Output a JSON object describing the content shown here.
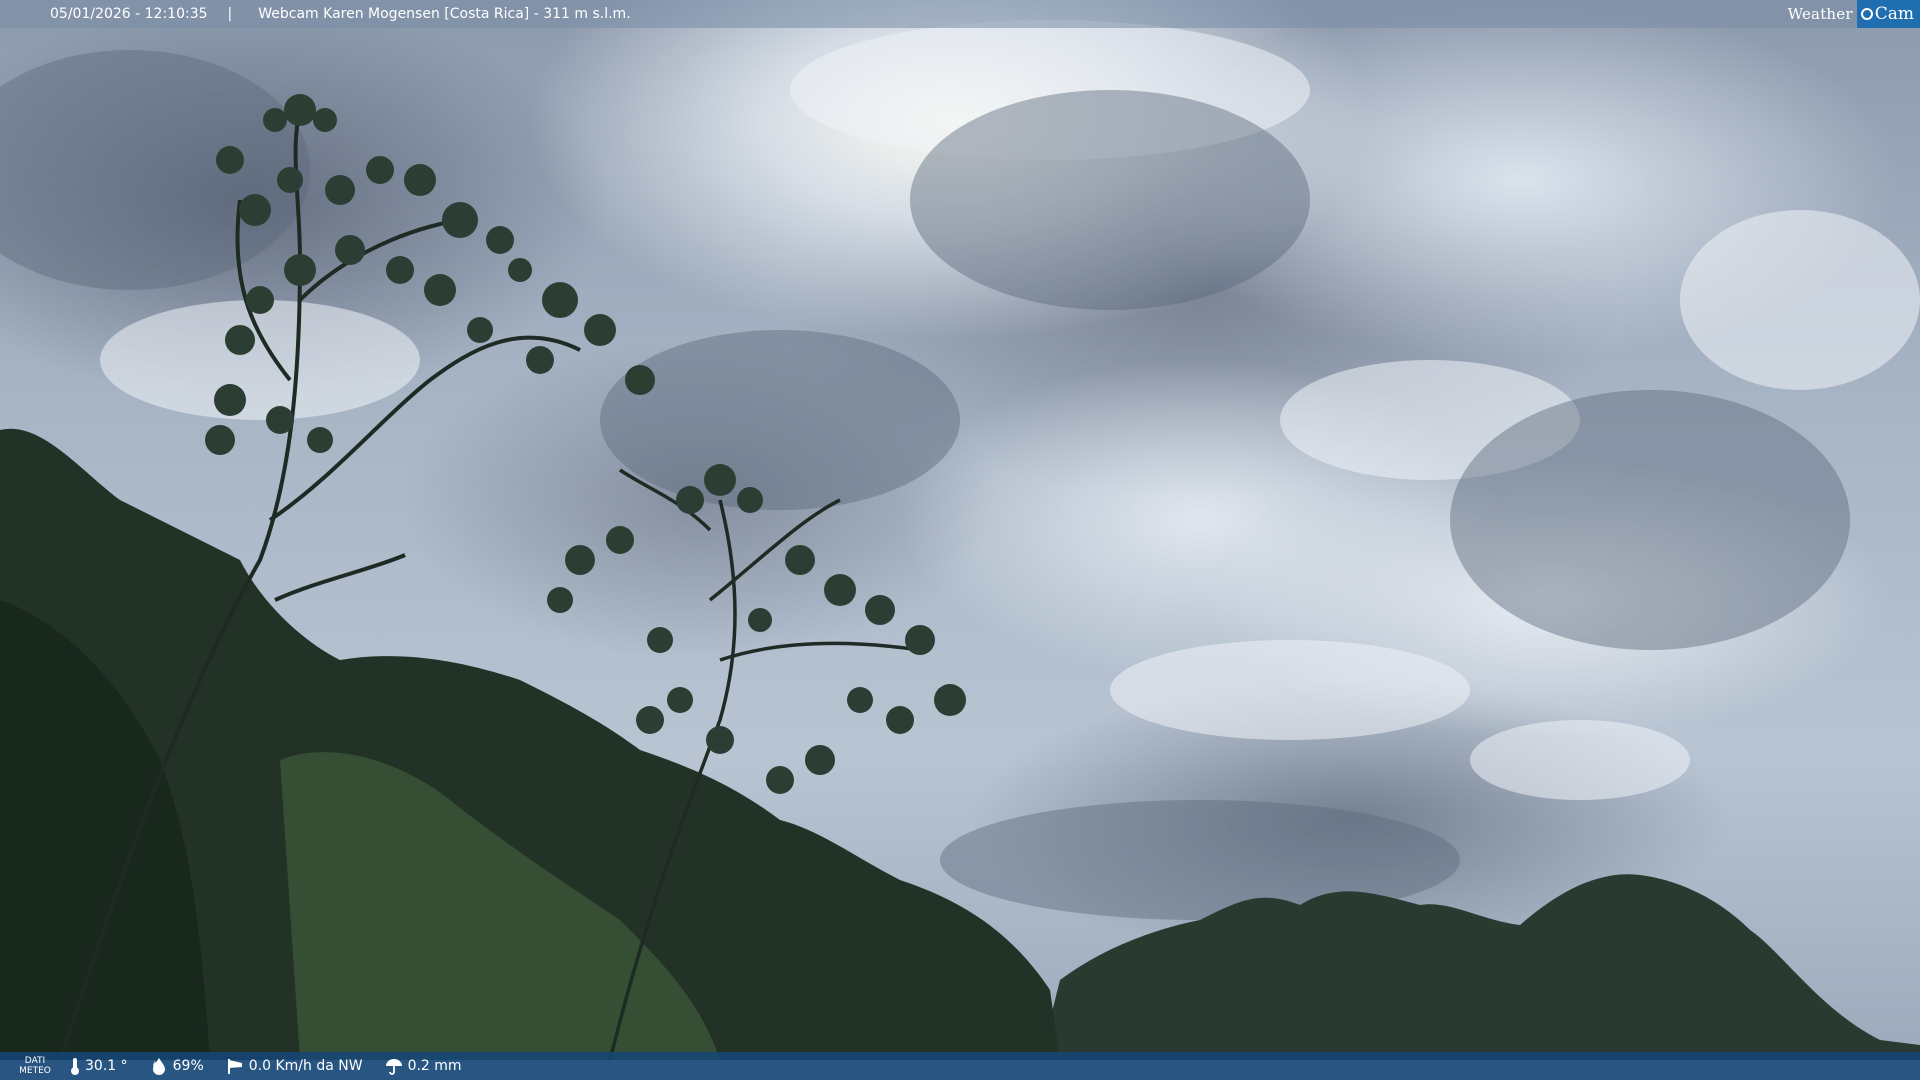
{
  "overlay": {
    "datetime": "05/01/2026 - 12:10:35",
    "separator": "|",
    "location": "Webcam Karen Mogensen [Costa Rica]  - 311 m s.l.m.",
    "logo_word": "Weather",
    "logo_cam": "Cam",
    "logo_accent": "#1f6fb0"
  },
  "weather": {
    "label_line1": "DATI",
    "label_line2": "METEO",
    "temperature": "30.1 °",
    "humidity": "69%",
    "wind": "0.0 Km/h da NW",
    "rain": "0.2 mm",
    "icons": [
      "thermometer-icon",
      "humidity-drop-icon",
      "wind-sock-icon",
      "rain-umbrella-icon"
    ]
  }
}
